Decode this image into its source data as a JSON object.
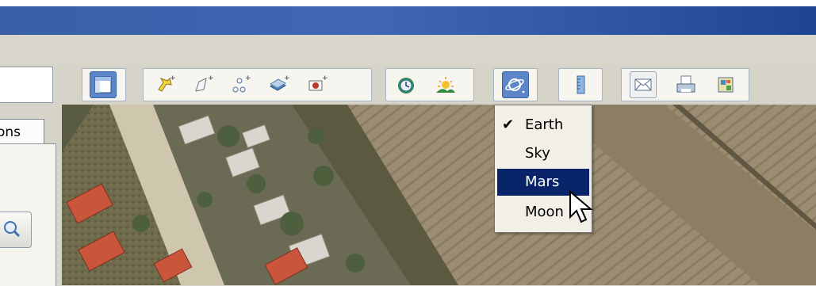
{
  "left_panel": {
    "tab_label": "ons"
  },
  "toolbar": {
    "buttons": [
      "sidebar-toggle",
      "add-placemark",
      "add-polygon",
      "add-path",
      "add-overlay",
      "record-tour",
      "historical-imagery",
      "sunlight",
      "switch-planet",
      "ruler",
      "email",
      "print",
      "view-in-maps"
    ]
  },
  "planet_menu": {
    "items": [
      {
        "label": "Earth",
        "checked": true
      },
      {
        "label": "Sky",
        "checked": false
      },
      {
        "label": "Mars",
        "checked": false,
        "highlighted": true
      },
      {
        "label": "Moon",
        "checked": false
      }
    ]
  },
  "colors": {
    "titlebar": "#3a5fa8",
    "menu_highlight": "#0a246a",
    "active_button": "#5d86c9"
  }
}
